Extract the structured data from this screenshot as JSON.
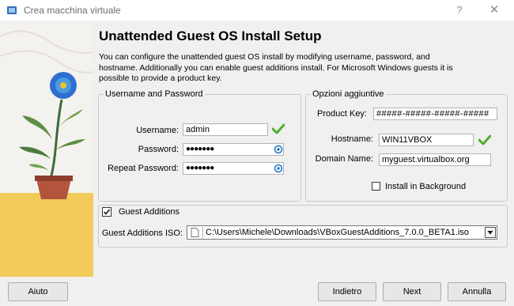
{
  "window": {
    "title": "Crea macchina virtuale",
    "help_icon": "?",
    "close_icon": "✕"
  },
  "heading": "Unattended Guest OS Install Setup",
  "description": "You can configure the unattended guest OS install by modifying username, password, and hostname. Additionally you can enable guest additions install. For Microsoft Windows guests it is possible to provide a product key.",
  "user_group": {
    "legend": "Username and Password",
    "username_label": "Username:",
    "username_value": "admin",
    "password_label": "Password:",
    "password_value": "●●●●●●●",
    "repeat_label": "Repeat Password:",
    "repeat_value": "●●●●●●●"
  },
  "options_group": {
    "legend": "Opzioni aggiuntive",
    "product_key_label": "Product Key:",
    "product_key_value": "#####-#####-#####-#####",
    "hostname_label": "Hostname:",
    "hostname_value": "WIN11VBOX",
    "domain_label": "Domain Name:",
    "domain_value": "myguest.virtualbox.org",
    "background_label": "Install in Background",
    "background_checked": false
  },
  "guest_additions": {
    "label": "Guest Additions",
    "checked": true,
    "iso_label": "Guest Additions ISO:",
    "iso_value": "C:\\Users\\Michele\\Downloads\\VBoxGuestAdditions_7.0.0_BETA1.iso"
  },
  "buttons": {
    "help": "Aiuto",
    "back": "Indietro",
    "next": "Next",
    "cancel": "Annulla"
  },
  "colors": {
    "accent_check": "#4caf2a",
    "eye_icon": "#1a73c8"
  }
}
